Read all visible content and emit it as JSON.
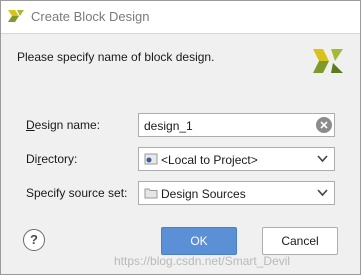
{
  "window": {
    "title": "Create Block Design"
  },
  "prompt": "Please specify name of block design.",
  "form": {
    "design_name": {
      "label_underlined": "D",
      "label_rest": "esign name:",
      "value": "design_1"
    },
    "directory": {
      "label_pre": "Di",
      "label_underlined": "r",
      "label_rest": "ectory:",
      "value": "<Local to Project>"
    },
    "source_set": {
      "label": "Specify source set:",
      "value": "Design Sources"
    }
  },
  "buttons": {
    "help": "?",
    "ok": "OK",
    "cancel": "Cancel"
  },
  "watermark": "https://blog.csdn.net/Smart_Devil",
  "colors": {
    "ok_button": "#5b8fd6",
    "logo_yellow": "#d9c21c",
    "logo_green": "#7f9a2a",
    "dialog_bg": "#f0f0f0"
  },
  "icons": [
    "vivado-logo-icon",
    "clear-icon",
    "local-project-icon",
    "folder-icon",
    "chevron-down-icon",
    "help-icon"
  ]
}
